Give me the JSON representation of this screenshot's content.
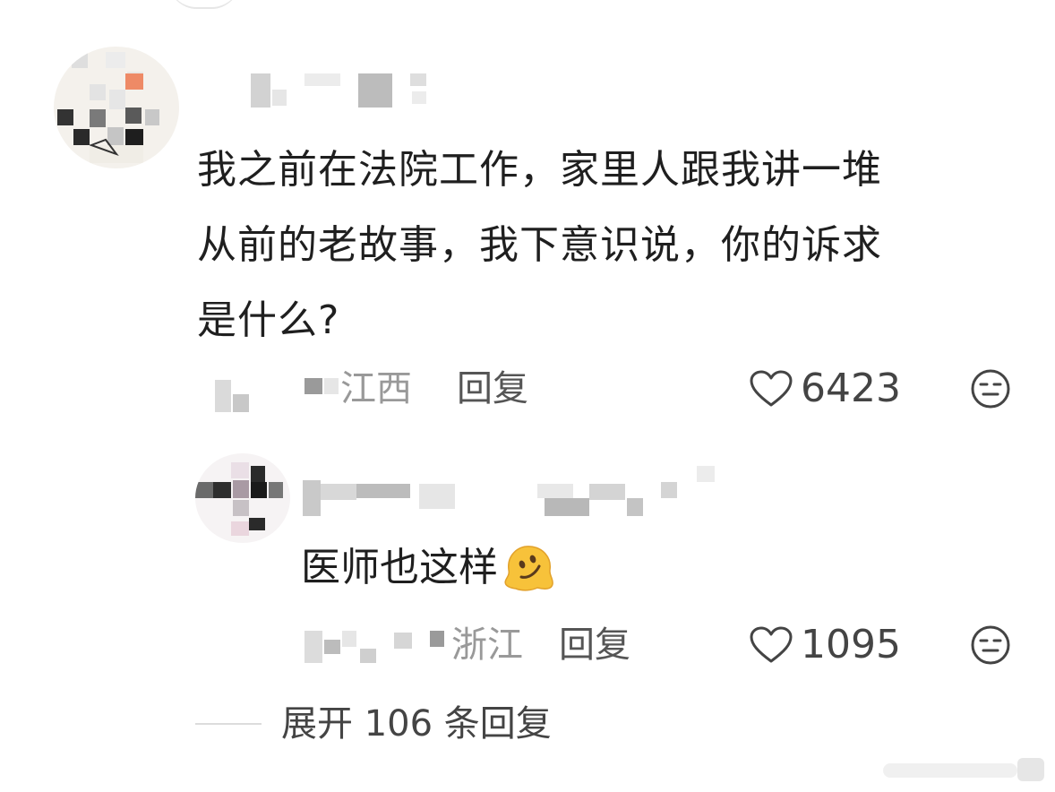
{
  "main_comment": {
    "text_lines": [
      "我之前在法院工作，家里人跟我讲一堆",
      "从前的老故事，我下意识说，你的诉求",
      "是什么?"
    ],
    "location": "江西",
    "reply_label": "回复",
    "like_count": "6423",
    "icons": {
      "like": "heart-outline-icon",
      "emoji": "neutral-face-icon"
    }
  },
  "reply_comment": {
    "text": "医师也这样",
    "emoji": "melting-face-emoji",
    "location": "浙江",
    "reply_label": "回复",
    "like_count": "1095",
    "icons": {
      "like": "heart-outline-icon",
      "emoji": "neutral-face-icon"
    }
  },
  "expand_replies": {
    "label": "展开 106 条回复"
  },
  "colors": {
    "text": "#1f1f1f",
    "meta_text": "#999999",
    "action_text": "#555555",
    "emoji_yellow": "#f7c23a"
  }
}
